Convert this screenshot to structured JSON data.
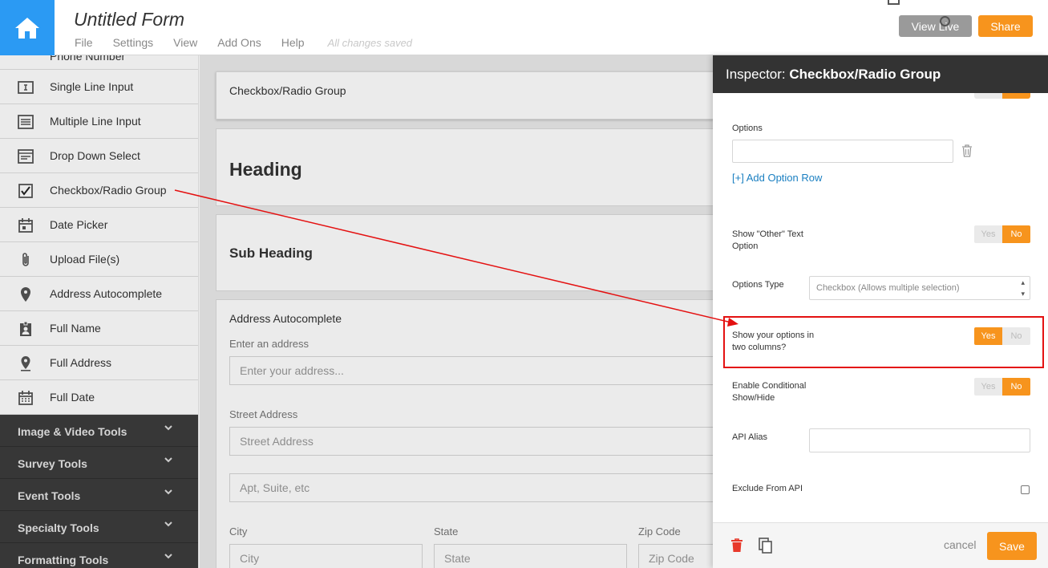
{
  "app": {
    "form_title": "Untitled Form",
    "menu": [
      "File",
      "Settings",
      "View",
      "Add Ons",
      "Help"
    ],
    "save_status": "All changes saved",
    "view_live_label": "View Live",
    "share_label": "Share",
    "accent_color": "#f7941d",
    "home_color": "#2b9af3"
  },
  "sidebar": {
    "partial_label": "Phone Number",
    "items": [
      {
        "label": "Single Line Input",
        "icon": "text-input-icon"
      },
      {
        "label": "Multiple Line Input",
        "icon": "textarea-icon"
      },
      {
        "label": "Drop Down Select",
        "icon": "dropdown-icon"
      },
      {
        "label": "Checkbox/Radio Group",
        "icon": "checkbox-icon"
      },
      {
        "label": "Date Picker",
        "icon": "calendar-icon"
      },
      {
        "label": "Upload File(s)",
        "icon": "paperclip-icon"
      },
      {
        "label": "Address Autocomplete",
        "icon": "location-pin-icon"
      },
      {
        "label": "Full Name",
        "icon": "id-badge-icon"
      },
      {
        "label": "Full Address",
        "icon": "location-pin-icon"
      },
      {
        "label": "Full Date",
        "icon": "calendar-icon"
      }
    ],
    "categories": [
      {
        "label": "Image & Video Tools"
      },
      {
        "label": "Survey Tools"
      },
      {
        "label": "Event Tools"
      },
      {
        "label": "Specialty Tools"
      },
      {
        "label": "Formatting Tools"
      }
    ]
  },
  "canvas": {
    "checkbox_card_label": "Checkbox/Radio Group",
    "heading": "Heading",
    "sub_heading": "Sub Heading",
    "address": {
      "title": "Address Autocomplete",
      "enter_label": "Enter an address",
      "enter_placeholder": "Enter your address...",
      "street_label": "Street Address",
      "street_placeholder": "Street Address",
      "apt_placeholder": "Apt, Suite, etc",
      "city_label": "City",
      "city_placeholder": "City",
      "state_label": "State",
      "state_placeholder": "State",
      "zip_label": "Zip Code",
      "zip_placeholder": "Zip Code"
    }
  },
  "inspector": {
    "title_prefix": "Inspector:",
    "title_name": "Checkbox/Radio Group",
    "options_label": "Options",
    "options_value": "",
    "add_option_row": "[+] Add Option Row",
    "show_other_label": "Show \"Other\" Text Option",
    "show_other": {
      "yes": "Yes",
      "no": "No",
      "selected": "No"
    },
    "options_type_label": "Options Type",
    "options_type_value": "Checkbox (Allows multiple selection)",
    "two_columns_label": "Show your options in two columns?",
    "two_columns": {
      "yes": "Yes",
      "no": "No",
      "selected": "Yes"
    },
    "conditional_label": "Enable Conditional Show/Hide",
    "conditional": {
      "yes": "Yes",
      "no": "No",
      "selected": "No"
    },
    "api_alias_label": "API Alias",
    "api_alias_value": "",
    "exclude_api_label": "Exclude From API",
    "exclude_api_checked": false,
    "cancel_label": "cancel",
    "save_label": "Save"
  },
  "annotation": {
    "color": "#e41111"
  }
}
